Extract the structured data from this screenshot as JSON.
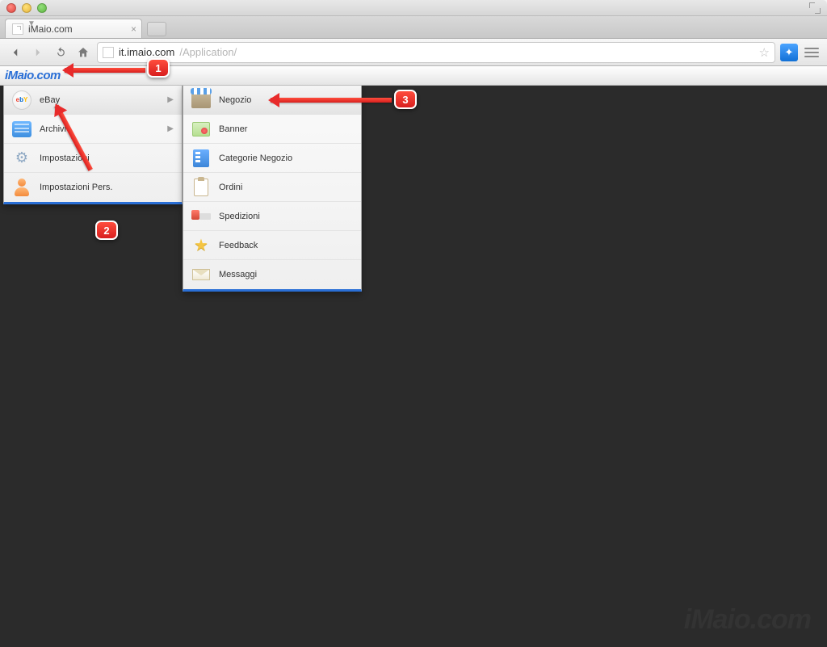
{
  "browser": {
    "tab_title": "iMaio.com",
    "url_host": "it.imaio.com",
    "url_path": "/Application/"
  },
  "app": {
    "logo": "iMaio.com",
    "watermark": "iMaio.com"
  },
  "primary_menu": [
    {
      "label": "eBay",
      "has_submenu": true
    },
    {
      "label": "Archivi",
      "has_submenu": true
    },
    {
      "label": "Impostazioni",
      "has_submenu": false
    },
    {
      "label": "Impostazioni Pers.",
      "has_submenu": false
    }
  ],
  "secondary_menu": [
    {
      "label": "Negozio"
    },
    {
      "label": "Banner"
    },
    {
      "label": "Categorie Negozio"
    },
    {
      "label": "Ordini"
    },
    {
      "label": "Spedizioni"
    },
    {
      "label": "Feedback"
    },
    {
      "label": "Messaggi"
    }
  ],
  "annotations": {
    "c1": "1",
    "c2": "2",
    "c3": "3"
  }
}
